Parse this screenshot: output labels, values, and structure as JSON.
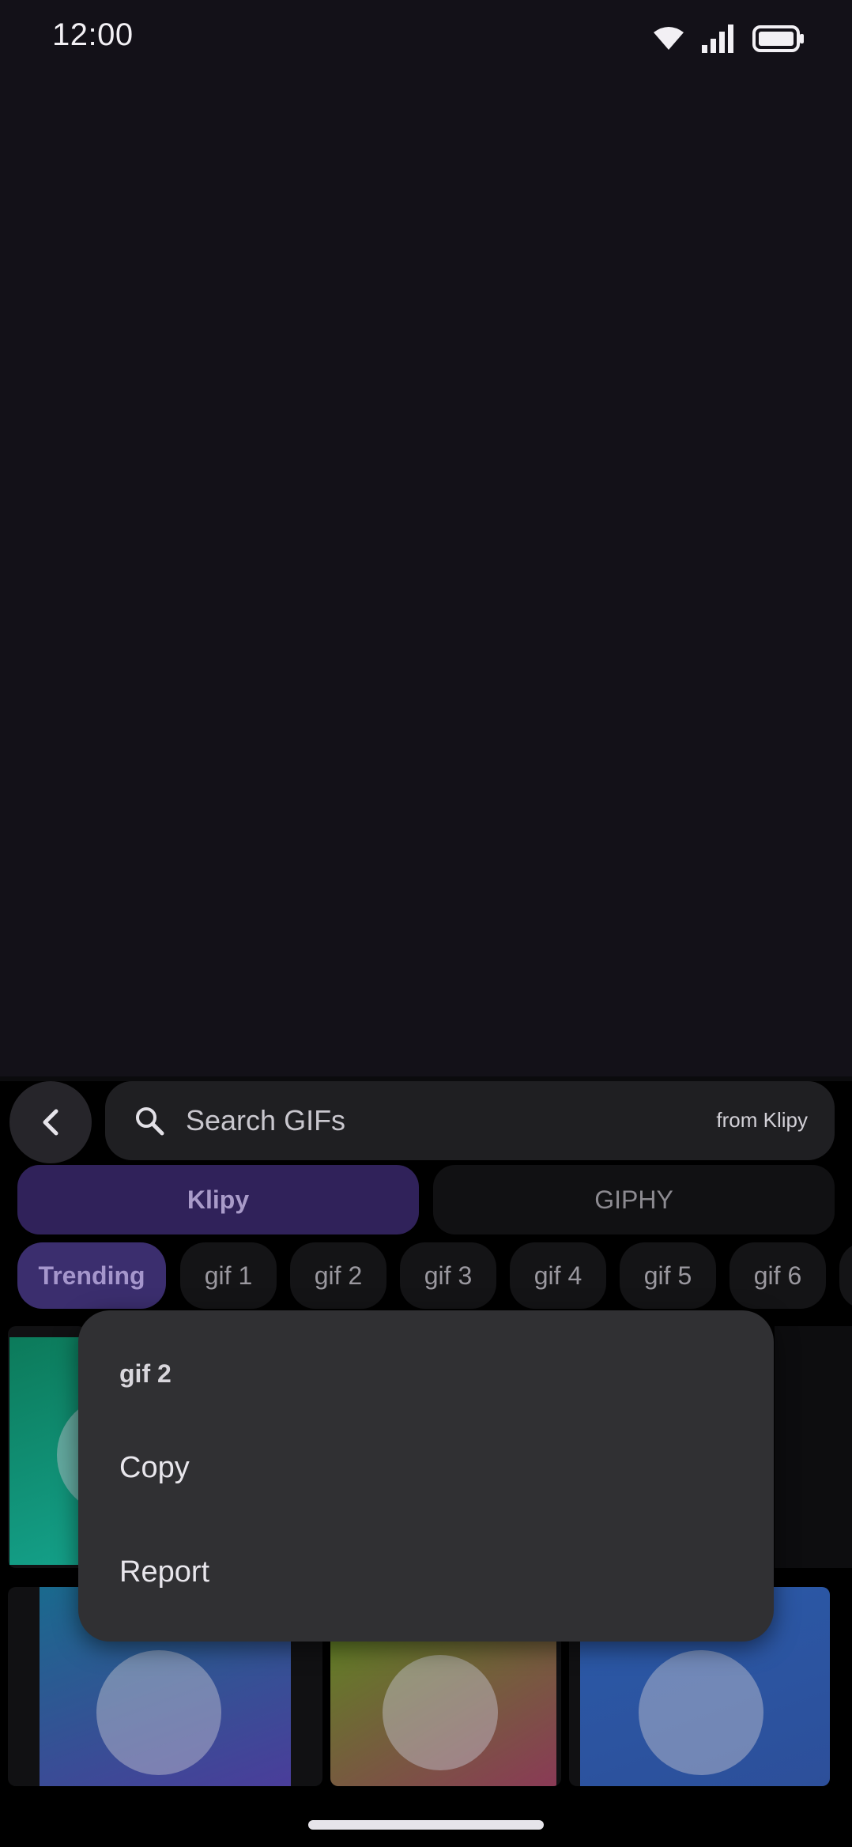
{
  "status_bar": {
    "time": "12:00"
  },
  "search": {
    "placeholder": "Search GIFs",
    "source_label": "from Klipy"
  },
  "provider_tabs": [
    {
      "label": "Klipy",
      "selected": true
    },
    {
      "label": "GIPHY",
      "selected": false
    }
  ],
  "categories": [
    "Trending",
    "gif 1",
    "gif 2",
    "gif 3",
    "gif 4",
    "gif 5",
    "gif 6"
  ],
  "context_menu": {
    "title": "gif 2",
    "items": [
      "Copy",
      "Report"
    ]
  },
  "colors": {
    "background": "#131118",
    "accent": "#30225a",
    "menu_background": "#303033"
  },
  "icons": {
    "back": "chevron-left-icon",
    "search": "search-icon",
    "wifi": "wifi-icon",
    "signal": "signal-icon",
    "battery": "battery-icon"
  }
}
